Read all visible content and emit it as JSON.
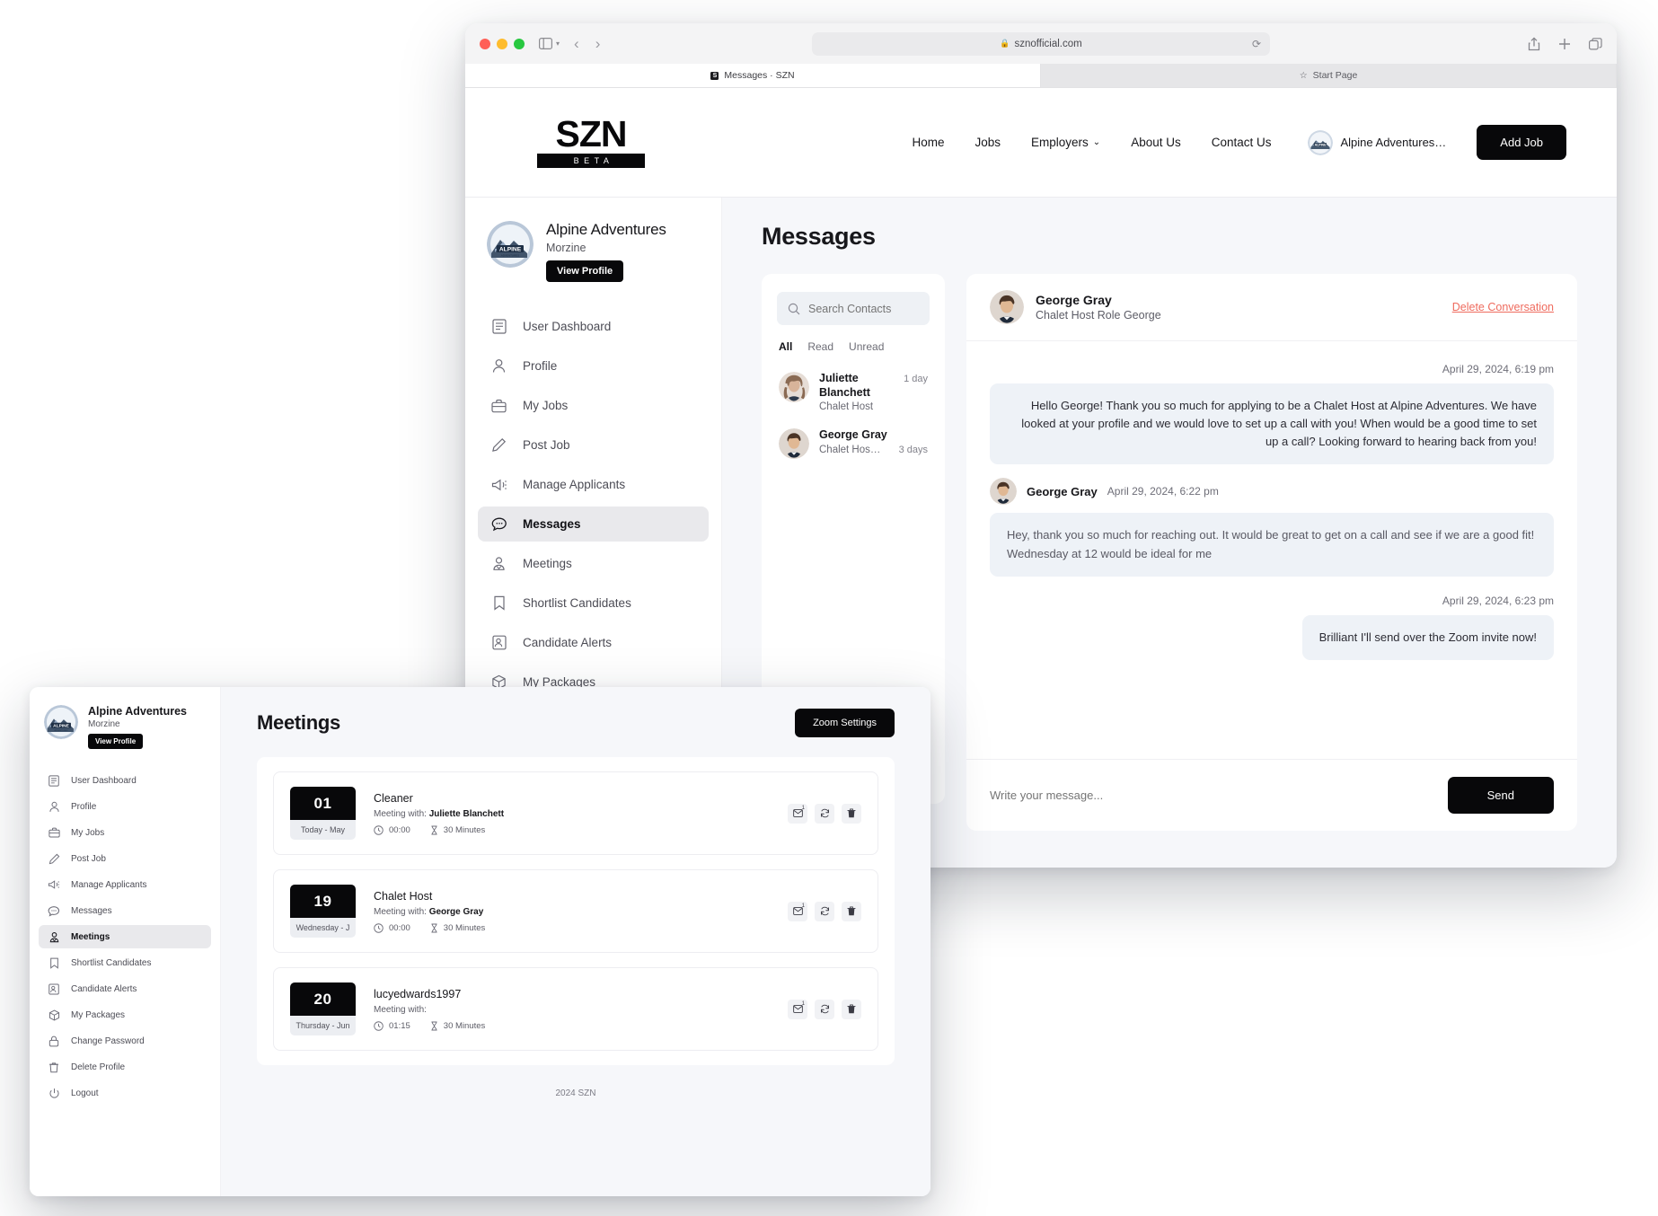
{
  "browser": {
    "url": "sznofficial.com",
    "lock_icon": "lock-icon",
    "reload_icon": "reload-icon",
    "tabs": [
      {
        "title": "Messages · SZN",
        "favicon": "S",
        "active": true
      },
      {
        "title": "Start Page",
        "favicon": "star-icon",
        "active": false
      }
    ],
    "toolbar_icons": [
      "share-icon",
      "new-tab-icon",
      "tab-overview-icon"
    ]
  },
  "site_header": {
    "logo": "SZN",
    "logo_sub": "BETA",
    "nav": [
      {
        "label": "Home"
      },
      {
        "label": "Jobs"
      },
      {
        "label": "Employers",
        "caret": true
      },
      {
        "label": "About Us"
      },
      {
        "label": "Contact Us"
      }
    ],
    "account_name": "Alpine Adventures…",
    "add_job_label": "Add Job"
  },
  "sidebar": {
    "company": "Alpine Adventures",
    "location": "Morzine",
    "view_profile_label": "View Profile",
    "items": [
      {
        "label": "User Dashboard",
        "icon": "dashboard-icon"
      },
      {
        "label": "Profile",
        "icon": "person-icon"
      },
      {
        "label": "My Jobs",
        "icon": "briefcase-icon"
      },
      {
        "label": "Post Job",
        "icon": "pencil-icon"
      },
      {
        "label": "Manage Applicants",
        "icon": "megaphone-icon"
      },
      {
        "label": "Messages",
        "icon": "chat-icon"
      },
      {
        "label": "Meetings",
        "icon": "user-badge-icon"
      },
      {
        "label": "Shortlist Candidates",
        "icon": "bookmark-icon"
      },
      {
        "label": "Candidate Alerts",
        "icon": "alert-person-icon"
      },
      {
        "label": "My Packages",
        "icon": "box-icon"
      },
      {
        "label": "Change Password",
        "icon": "lock-icon"
      },
      {
        "label": "Delete Profile",
        "icon": "trash-icon"
      },
      {
        "label": "Logout",
        "icon": "power-icon"
      }
    ],
    "active_messages": "Messages",
    "active_meetings": "Meetings"
  },
  "messages_page": {
    "title": "Messages",
    "search": {
      "placeholder": "Search Contacts",
      "icon": "search-icon"
    },
    "filters": [
      {
        "label": "All",
        "active": true
      },
      {
        "label": "Read",
        "active": false
      },
      {
        "label": "Unread",
        "active": false
      }
    ],
    "contacts": [
      {
        "name": "Juliette Blanchett",
        "role": "Chalet Host",
        "time": "1 day"
      },
      {
        "name": "George Gray",
        "role": "Chalet Hos…",
        "time": "3 days"
      }
    ],
    "conversation": {
      "name": "George Gray",
      "subtitle": "Chalet Host Role George",
      "delete_label": "Delete Conversation",
      "messages": [
        {
          "align": "right",
          "timestamp": "April 29, 2024, 6:19 pm",
          "text": "Hello George! Thank you so much for applying to be a Chalet Host at Alpine Adventures. We have looked at your profile and we would love to set up a call with you! When would be a good time to set up a call? Looking forward to hearing back from you!"
        },
        {
          "align": "left",
          "sender": "George Gray",
          "timestamp": "April 29, 2024, 6:22 pm",
          "text": "Hey, thank you so much for reaching out. It would be great to get on a call and see if we are a good fit! Wednesday at 12 would be ideal for me"
        },
        {
          "align": "right",
          "timestamp": "April 29, 2024, 6:23 pm",
          "text": "Brilliant I'll send over the Zoom invite now!"
        }
      ],
      "compose_placeholder": "Write your message...",
      "send_label": "Send"
    }
  },
  "meetings_page": {
    "title": "Meetings",
    "zoom_settings_label": "Zoom Settings",
    "footer": "2024 SZN",
    "meetings": [
      {
        "day_number": "01",
        "day_label": "Today - May",
        "role": "Cleaner",
        "with_prefix": "Meeting with:",
        "with_name": "Juliette Blanchett",
        "time": "00:00",
        "duration": "30 Minutes",
        "actions": [
          "email-icon",
          "reschedule-icon",
          "trash-icon"
        ]
      },
      {
        "day_number": "19",
        "day_label": "Wednesday - J",
        "role": "Chalet Host",
        "with_prefix": "Meeting with:",
        "with_name": "George Gray",
        "time": "00:00",
        "duration": "30 Minutes",
        "actions": [
          "email-icon",
          "reschedule-icon",
          "trash-icon"
        ]
      },
      {
        "day_number": "20",
        "day_label": "Thursday - Jun",
        "role": "lucyedwards1997",
        "with_prefix": "Meeting with:",
        "with_name": "",
        "time": "01:15",
        "duration": "30 Minutes",
        "actions": [
          "email-icon",
          "reschedule-icon",
          "trash-icon"
        ]
      }
    ]
  },
  "colors": {
    "accent_black": "#08080a",
    "bubble": "#eef2f7",
    "danger": "#ef6b5e",
    "page_bg": "#f6f7fa"
  }
}
